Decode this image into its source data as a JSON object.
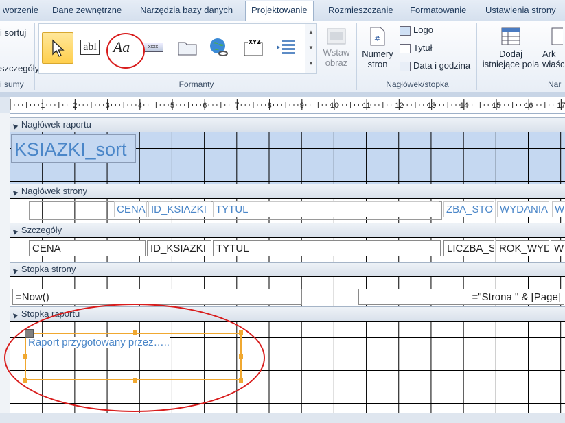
{
  "tabs": [
    {
      "label": "worzenie"
    },
    {
      "label": "Dane zewnętrzne"
    },
    {
      "label": "Narzędzia bazy danych"
    },
    {
      "label": "Projektowanie"
    },
    {
      "label": "Rozmieszczanie"
    },
    {
      "label": "Formatowanie"
    },
    {
      "label": "Ustawienia strony"
    }
  ],
  "ribbon": {
    "left_items": [
      "i sortuj",
      "szczegóły"
    ],
    "left_group": "i sumy",
    "controls_group": "Formanty",
    "textbox_icon_text": "abl",
    "label_icon_text": "Aa",
    "insert_image": {
      "line1": "Wstaw",
      "line2": "obraz"
    },
    "page_numbers": {
      "line1": "Numery",
      "line2": "stron"
    },
    "logo": "Logo",
    "title": "Tytuł",
    "date_time": "Data i godzina",
    "header_group": "Nagłówek/stopka",
    "add_fields": {
      "line1": "Dodaj",
      "line2": "istniejące pola"
    },
    "property": {
      "line1": "Ark",
      "line2": "właści"
    },
    "right_group": "Nar"
  },
  "ruler": {
    "numbers": [
      "1",
      "2",
      "3",
      "4",
      "5",
      "6",
      "7",
      "8",
      "9",
      "10",
      "11",
      "12",
      "13",
      "14",
      "15",
      "16",
      "17"
    ]
  },
  "sections": {
    "report_header": "Nagłówek raportu",
    "page_header": "Nagłówek strony",
    "detail": "Szczegóły",
    "page_footer": "Stopka strony",
    "report_footer": "Stopka raportu"
  },
  "report_title": "KSIAZKI_sort",
  "page_header_labels": [
    "CENA",
    "ID_KSIAZKI",
    "TYTUL",
    "ZBA_STOR",
    "WYDANIA",
    "WY"
  ],
  "detail_fields": [
    "CENA",
    "ID_KSIAZKI",
    "TYTUL",
    "LICZBA_S",
    "ROK_WYD",
    "W"
  ],
  "footer_now": "=Now()",
  "footer_page": "=\"Strona \" & [Page]",
  "report_footer_label": "Raport przygotowany przez….."
}
